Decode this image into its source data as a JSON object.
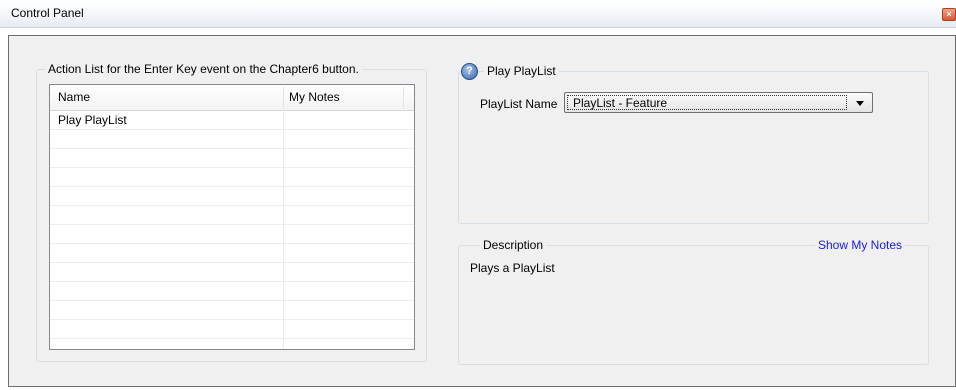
{
  "window": {
    "title": "Control Panel",
    "close_glyph": "×"
  },
  "action_list": {
    "legend": "Action List for the Enter Key event on the Chapter6 button.",
    "columns": [
      "Name",
      "My Notes"
    ],
    "rows": [
      {
        "name": "Play PlayList",
        "notes": ""
      }
    ]
  },
  "play_playlist": {
    "help_glyph": "?",
    "legend": "Play PlayList",
    "playlist_label": "PlayList Name",
    "playlist_value": "PlayList - Feature"
  },
  "description": {
    "legend": "Description",
    "show_notes_link": "Show My Notes",
    "text": "Plays a PlayList"
  },
  "colors": {
    "panel_bg": "#f0f0f0",
    "link": "#1a1ae6",
    "close_button": "#d85a3c"
  },
  "icons": [
    "close-icon",
    "help-icon",
    "dropdown-arrow-icon"
  ]
}
